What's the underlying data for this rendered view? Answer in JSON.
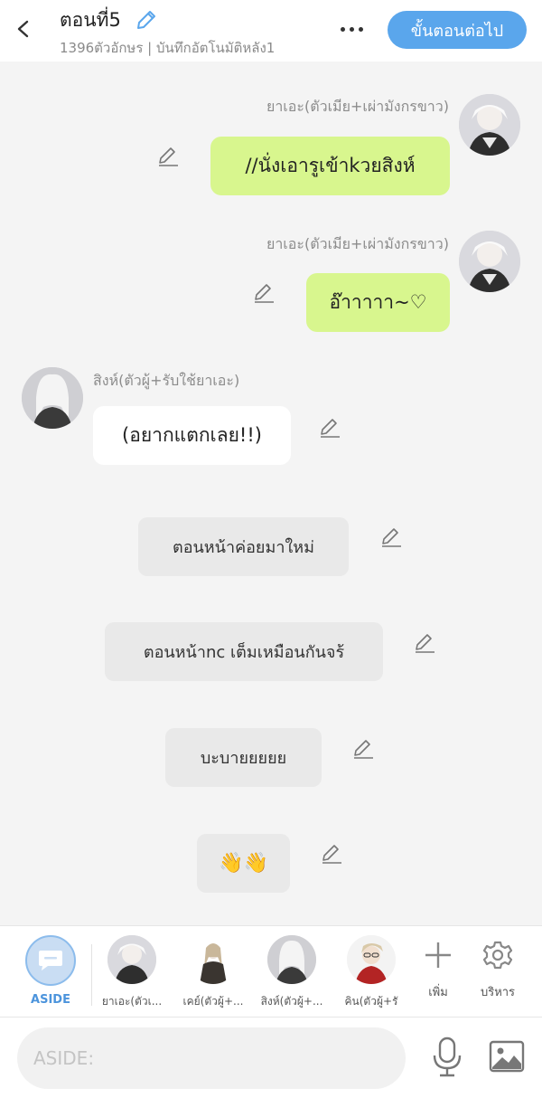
{
  "header": {
    "title": "ตอนที่5",
    "subtitle": "1396ตัวอักษร | บันทึกอัตโนมัติหลัง1",
    "next_button": "ขั้นตอนต่อไป"
  },
  "messages": [
    {
      "type": "char",
      "side": "right",
      "name": "ยาเอะ(ตัวเมีย+เผ่ามังกรขาว)",
      "text": "//นั่งเอารูเข้าkวยสิงห์"
    },
    {
      "type": "char",
      "side": "right",
      "name": "ยาเอะ(ตัวเมีย+เผ่ามังกรขาว)",
      "text": "อ๊าาาาา~♡"
    },
    {
      "type": "char",
      "side": "left",
      "name": "สิงห์(ตัวผู้+รับใช้ยาเอะ)",
      "text": "(อยากแตกเลย!!)"
    },
    {
      "type": "aside",
      "text": "ตอนหน้าค่อยมาใหม่"
    },
    {
      "type": "aside",
      "text": "ตอนหน้าnc เต็มเหมือนกันจร้"
    },
    {
      "type": "aside",
      "text": "บะบายยยยย"
    },
    {
      "type": "aside",
      "text": "👋👋"
    }
  ],
  "charbar": {
    "aside_label": "ASIDE",
    "characters": [
      {
        "label": "ยาเอะ(ตัวเ..."
      },
      {
        "label": "เคย์(ตัวผู้+..."
      },
      {
        "label": "สิงห์(ตัวผู้+..."
      },
      {
        "label": "คิน(ตัวผู้+รั"
      }
    ],
    "add_label": "เพิ่ม",
    "manage_label": "บริหาร"
  },
  "input": {
    "placeholder": "ASIDE:"
  },
  "colors": {
    "accent": "#5aa6ec",
    "bubble_right": "#d8f68e",
    "bubble_left": "#ffffff",
    "aside_bubble": "#e9e9e9",
    "background": "#f4f4f4"
  }
}
